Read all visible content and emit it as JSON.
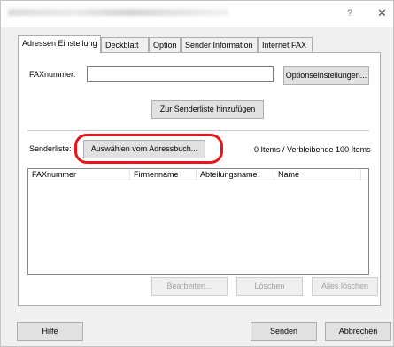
{
  "window": {
    "help_glyph": "?",
    "close_glyph": "✕"
  },
  "tabs": [
    {
      "label": "Adressen Einstellung",
      "active": true
    },
    {
      "label": "Deckblatt"
    },
    {
      "label": "Option"
    },
    {
      "label": "Sender Information"
    },
    {
      "label": "Internet FAX"
    }
  ],
  "fax": {
    "label": "FAXnummer:",
    "value": "",
    "options_button": "Optionseinstellungen...",
    "add_button": "Zur Senderliste hinzufügen"
  },
  "senderlist": {
    "label": "Senderliste:",
    "addressbook_button": "Auswählen vom Adressbuch...",
    "count_text": "0 Items / Verbleibende 100 Items",
    "columns": [
      "FAXnummer",
      "Firmenname",
      "Abteilungsname",
      "Name"
    ],
    "rows": [],
    "edit_button": "Bearbeiten...",
    "delete_button": "Löschen",
    "delete_all_button": "Alles löschen"
  },
  "footer": {
    "help_button": "Hilfe",
    "send_button": "Senden",
    "cancel_button": "Abbrechen"
  },
  "colors": {
    "highlight_ring": "#e8141b",
    "dialog_bg": "#f0f0f0"
  }
}
